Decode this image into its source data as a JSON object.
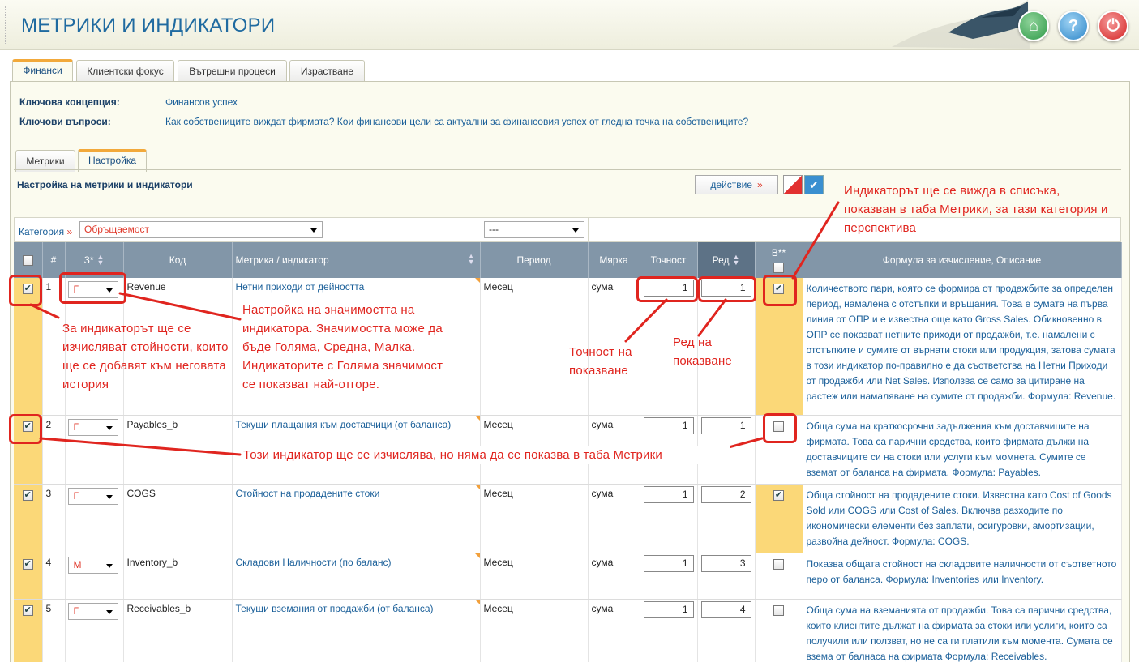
{
  "header": {
    "title": "МЕТРИКИ И ИНДИКАТОРИ",
    "home": "⌂",
    "help": "?",
    "power": "⏻"
  },
  "main_tabs": [
    {
      "label": "Финанси"
    },
    {
      "label": "Клиентски фокус"
    },
    {
      "label": "Вътрешни процеси"
    },
    {
      "label": "Израстване"
    }
  ],
  "concept": {
    "key_label": "Ключова концепция:",
    "key_value": "Финансов успех",
    "questions_label": "Ключови въпроси:",
    "questions_value": "Как собствениците виждат фирмата? Кои финансови цели са актуални за финансовия успех от гледна точка на собствениците?"
  },
  "sub_tabs": [
    {
      "label": "Метрики"
    },
    {
      "label": "Настройка"
    }
  ],
  "section": {
    "title": "Настройка на метрики и индикатори",
    "action_label": "действие",
    "action_arrow": "»"
  },
  "filter": {
    "category_label": "Категория",
    "category_arrow": "»",
    "category_value": "Обръщаемост",
    "period_value": "---"
  },
  "columns": {
    "num": "#",
    "z": "З*",
    "code": "Код",
    "metric": "Метрика / индикатор",
    "period": "Период",
    "unit": "Мярка",
    "precision": "Точност",
    "order": "Ред",
    "b": "В**",
    "formula": "Формула за изчисление, Описание"
  },
  "rows": [
    {
      "num": "1",
      "z": "Г",
      "code": "Revenue",
      "metric": "Нетни приходи от дейността",
      "period": "Месец",
      "unit": "сума",
      "precision": "1",
      "order": "1",
      "b_checked": true,
      "checked": true,
      "desc": "Количеството пари, която се формира от продажбите за определен период, намалена с отстъпки и връщания. Това е сумата на първа линия от ОПР и е известна още като Gross Sales. Обикновенно в ОПР се показват нетните приходи от продажби, т.е. намалени с отстъпките и сумите от върнати стоки или продукция, затова сумата в този индикатор по-правилно е да съответства на Нетни Приходи от продажби или Net Sales. Използва се само за цитиране на растеж или намаляване на сумите от продажби. Формула: Revenue."
    },
    {
      "num": "2",
      "z": "Г",
      "code": "Payables_b",
      "metric": "Текущи плащания към доставчици (от баланса)",
      "period": "Месец",
      "unit": "сума",
      "precision": "1",
      "order": "1",
      "b_checked": false,
      "checked": true,
      "desc": "Обща сума на краткосрочни задължения към доставчиците на фирмата. Това са парични средства, които фирмата дължи на доставчиците си на стоки или услуги към момнета. Сумите се вземат от баланса на фирмата. Формула: Payables."
    },
    {
      "num": "3",
      "z": "Г",
      "code": "COGS",
      "metric": "Стойност на продадените стоки",
      "period": "Месец",
      "unit": "сума",
      "precision": "1",
      "order": "2",
      "b_checked": true,
      "checked": true,
      "desc": "Обща стойност на продадените стоки. Известна като Cost of Goods Sold или COGS или Cost of Sales. Включва разходите по икономически елементи без заплати, осигуровки, амортизации, развойна дейност. Формула: COGS."
    },
    {
      "num": "4",
      "z": "М",
      "code": "Inventory_b",
      "metric": "Складови Наличности (по баланс)",
      "period": "Месец",
      "unit": "сума",
      "precision": "1",
      "order": "3",
      "b_checked": false,
      "checked": true,
      "desc": "Показва общата стойност на складовите наличности от съответното перо от баланса. Формула: Inventories или Inventory."
    },
    {
      "num": "5",
      "z": "Г",
      "code": "Receivables_b",
      "metric": "Текущи вземания от продажби (от баланса)",
      "period": "Месец",
      "unit": "сума",
      "precision": "1",
      "order": "4",
      "b_checked": false,
      "checked": true,
      "desc": "Обща сума на вземанията от продажби. Това са парични средства, които клиентите дължат на фирмата за стоки или услиги, които са получили или ползват, но не са ги платили към момента. Сумата се взема от балнаса на фирмата Формула: Receivables."
    }
  ],
  "annotations": {
    "top_right": "Индикаторът ще се вижда в списъка, показван в таба Метрики, за тази категория и перспектива",
    "history": "За индикаторът ще се изчисляват стойности, които ще се добавят към неговата история",
    "significance": "Настройка на значимостта на индикатора. Значимостта може да бъде Голяма, Средна, Малка. Индикаторите с Голяма значимост се показват най-отгоре.",
    "precision": "Точност на показване",
    "order": "Ред на показване",
    "hidden": "Този индикатор ще се изчислява, но няма да се показва в таба Метрики"
  },
  "colors": {
    "accent": "#1f6aa0",
    "annotation": "#e0251f",
    "highlight": "#fbd878"
  }
}
